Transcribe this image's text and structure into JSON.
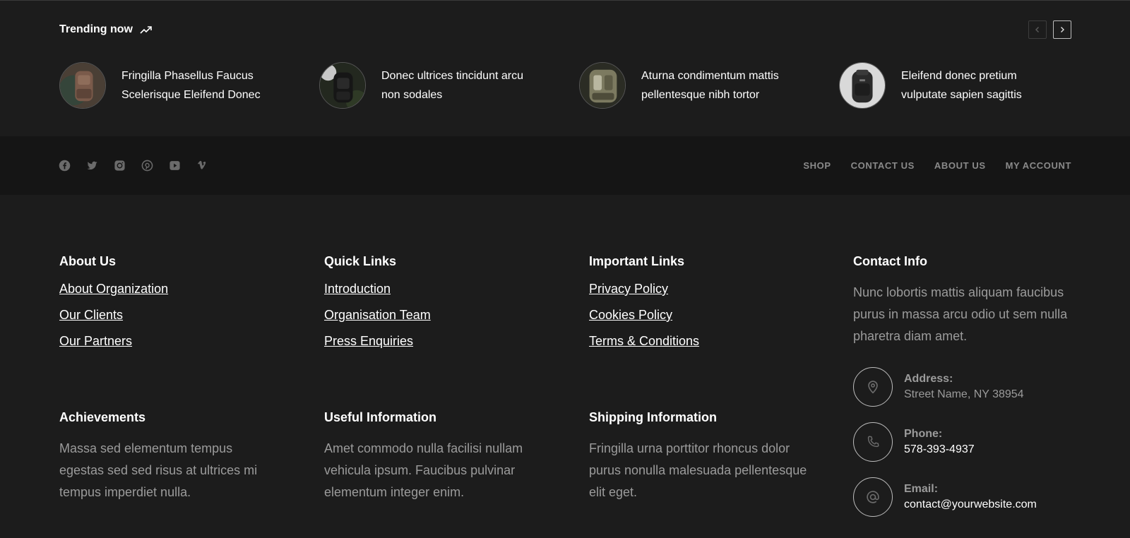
{
  "trending": {
    "title": "Trending now",
    "items": [
      {
        "text": "Fringilla Phasellus Faucus Scelerisque Eleifend Donec"
      },
      {
        "text": "Donec ultrices tincidunt arcu non sodales"
      },
      {
        "text": "Aturna condimentum mattis pellentesque nibh tortor"
      },
      {
        "text": "Eleifend donec pretium vulputate sapien sagittis"
      }
    ]
  },
  "social": [
    "facebook-icon",
    "twitter-icon",
    "instagram-icon",
    "pinterest-icon",
    "youtube-icon",
    "vimeo-icon"
  ],
  "topnav": [
    "SHOP",
    "CONTACT US",
    "ABOUT US",
    "MY ACCOUNT"
  ],
  "footer": {
    "about": {
      "title": "About Us",
      "links": [
        "About Organization",
        "Our Clients",
        "Our Partners"
      ]
    },
    "quick": {
      "title": "Quick Links",
      "links": [
        "Introduction",
        "Organisation Team",
        "Press Enquiries"
      ]
    },
    "important": {
      "title": "Important Links",
      "links": [
        "Privacy Policy",
        "Cookies Policy",
        "Terms & Conditions"
      ]
    },
    "contact": {
      "title": "Contact Info",
      "text": "Nunc lobortis mattis aliquam faucibus purus in massa arcu odio ut sem nulla pharetra diam amet.",
      "address_label": "Address:",
      "address": "Street Name, NY 38954",
      "phone_label": "Phone:",
      "phone": "578-393-4937",
      "email_label": "Email:",
      "email": "contact@yourwebsite.com"
    },
    "achievements": {
      "title": "Achievements",
      "text": "Massa sed elementum tempus egestas sed sed risus at ultrices mi tempus imperdiet nulla."
    },
    "useful": {
      "title": "Useful Information",
      "text": "Amet commodo nulla facilisi nullam vehicula ipsum. Faucibus pulvinar elementum integer enim."
    },
    "shipping": {
      "title": "Shipping Information",
      "text": "Fringilla urna porttitor rhoncus dolor purus nonulla malesuada pellentesque elit eget."
    }
  },
  "colors": {
    "background": "#1c1c1c",
    "bar": "#151515",
    "muted": "#9b9b9b",
    "nav": "#8a8a8a"
  }
}
